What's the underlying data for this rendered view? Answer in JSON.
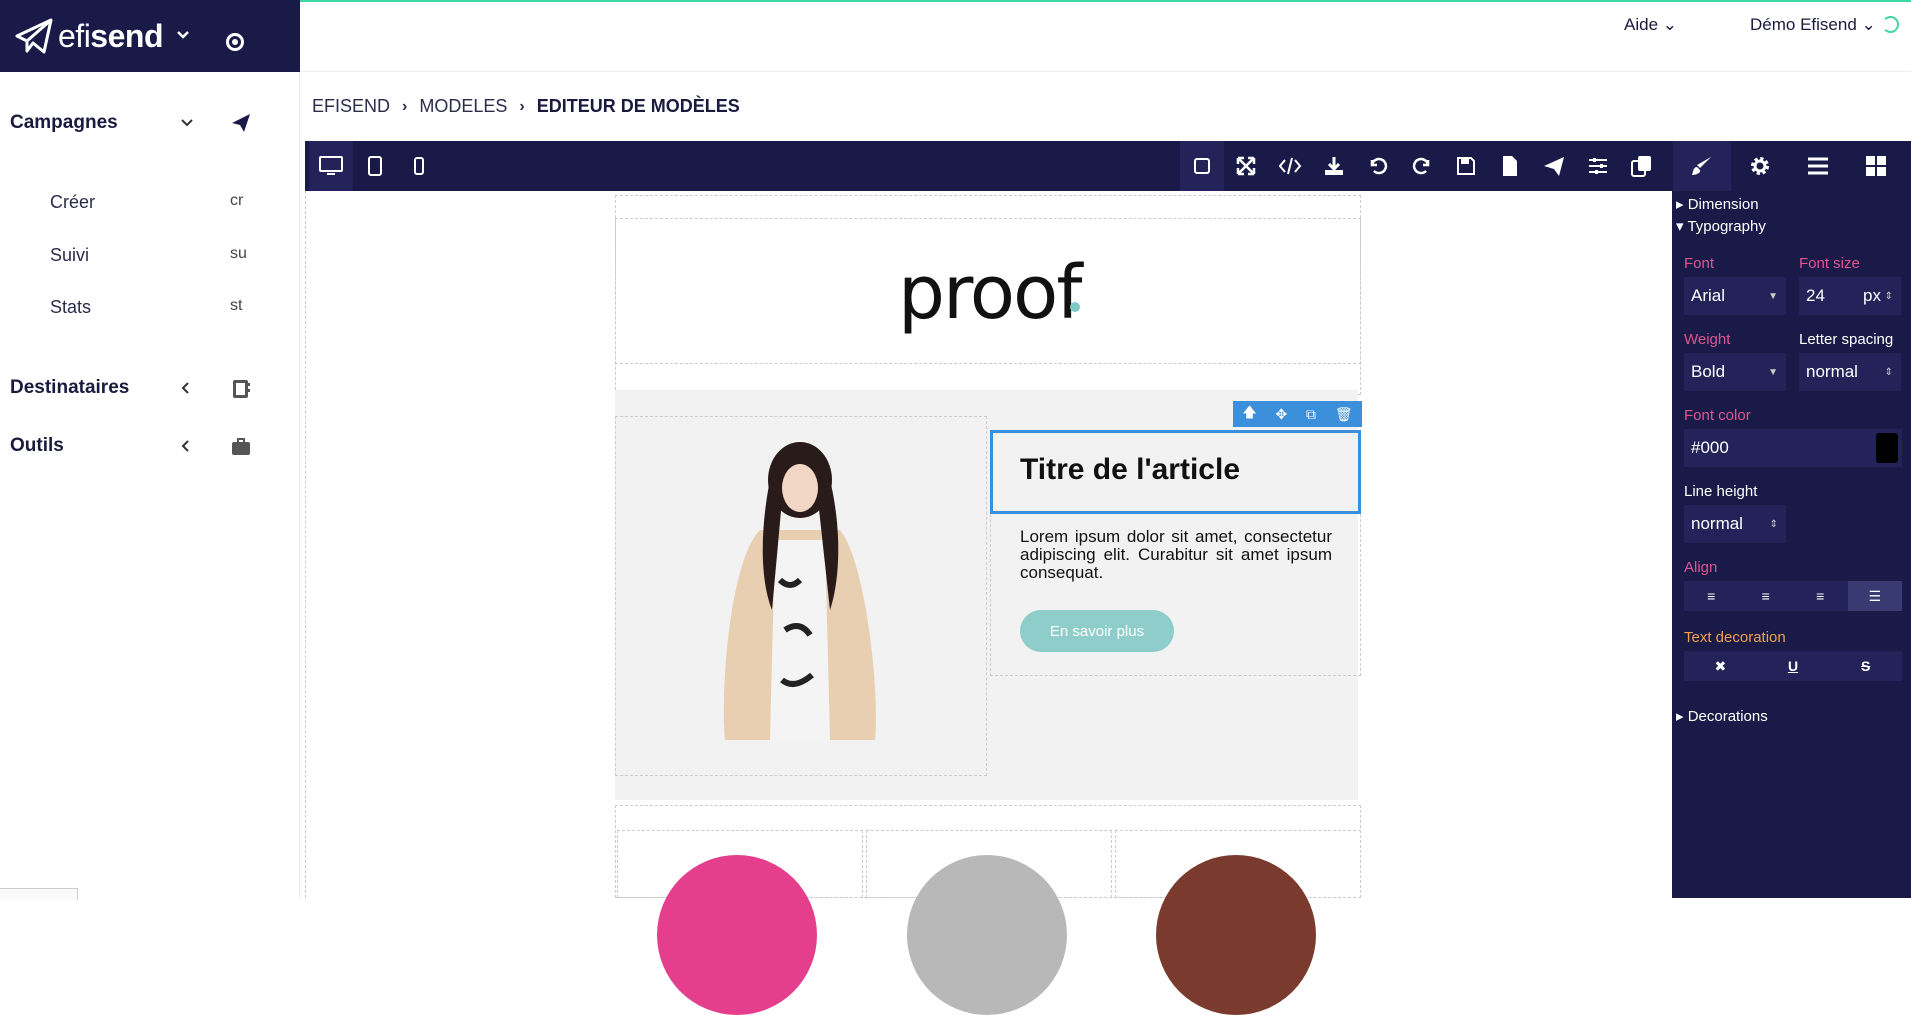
{
  "brand": {
    "name_light": "efi",
    "name_bold": "send"
  },
  "sidebar": {
    "sections": [
      {
        "label": "Campagnes",
        "icon": "paper-plane-icon",
        "items": [
          {
            "label": "Créer",
            "abbr": "cr"
          },
          {
            "label": "Suivi",
            "abbr": "su"
          },
          {
            "label": "Stats",
            "abbr": "st"
          }
        ]
      },
      {
        "label": "Destinataires",
        "icon": "address-book-icon"
      },
      {
        "label": "Outils",
        "icon": "briefcase-icon"
      }
    ]
  },
  "header": {
    "help": "Aide",
    "user": "Démo Efisend"
  },
  "breadcrumb": [
    "EFISEND",
    "MODELES",
    "EDITEUR DE MODÈLES"
  ],
  "panel": {
    "sections": {
      "dimension": "Dimension",
      "typography": "Typography",
      "decorations": "Decorations"
    },
    "labels": {
      "font": "Font",
      "font_size": "Font size",
      "weight": "Weight",
      "letter_spacing": "Letter spacing",
      "font_color": "Font color",
      "line_height": "Line height",
      "align": "Align",
      "text_decoration": "Text decoration"
    },
    "values": {
      "font": "Arial",
      "font_size": "24",
      "font_size_unit": "px",
      "weight": "Bold",
      "letter_spacing": "normal",
      "font_color": "#000",
      "line_height": "normal"
    },
    "align_options": [
      "left",
      "center",
      "right",
      "justify"
    ],
    "align_selected": "justify",
    "decoration_options": [
      "✖",
      "U",
      "S"
    ]
  },
  "template": {
    "logo": "proof",
    "article_title": "Titre de l'article",
    "article_body": "Lorem ipsum dolor sit amet, consectetur adipiscing elit. Curabitur sit amet ipsum consequat.",
    "cta": "En savoir plus"
  },
  "colors": {
    "navy": "#1a1a48",
    "accent": "#3dd6a5",
    "selection": "#3b8fdb",
    "cta": "#8fcdcb",
    "label_pink": "#e0548f"
  }
}
